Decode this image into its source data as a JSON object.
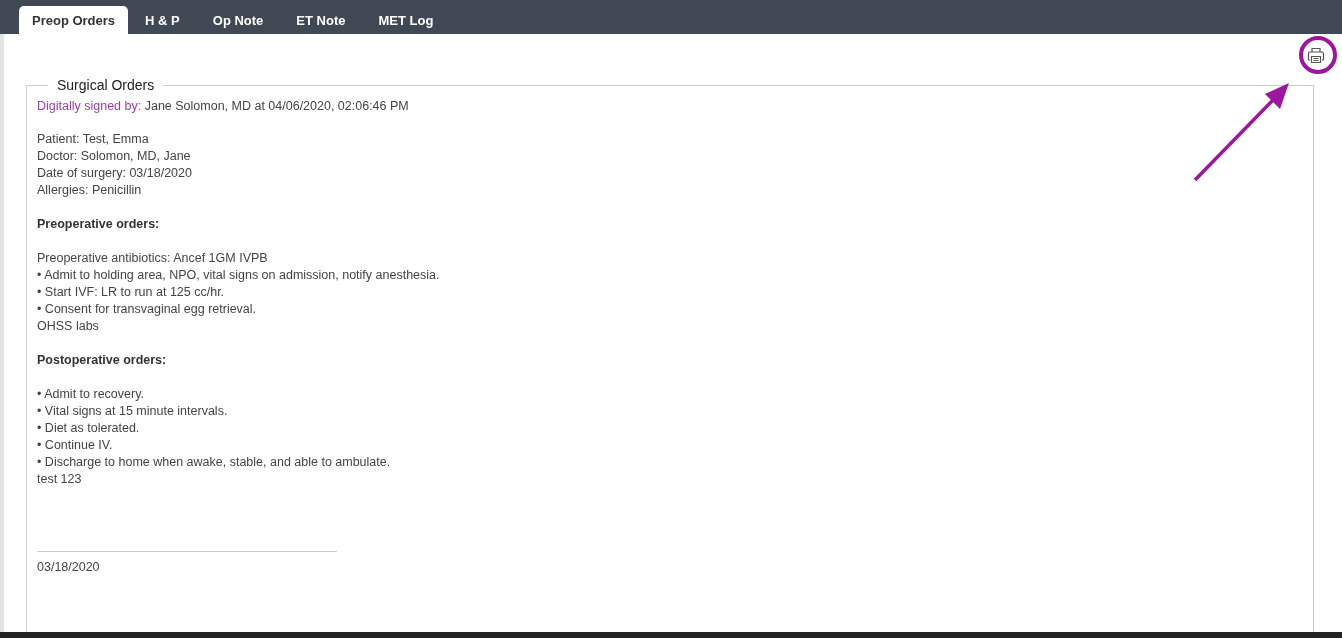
{
  "tabs": [
    {
      "label": "Preop Orders",
      "selected": true
    },
    {
      "label": "H & P",
      "selected": false
    },
    {
      "label": "Op Note",
      "selected": false
    },
    {
      "label": "ET Note",
      "selected": false
    },
    {
      "label": "MET Log",
      "selected": false
    }
  ],
  "document": {
    "title": "Surgical Orders",
    "signature": {
      "label": "Digitally signed by:",
      "value": "Jane Solomon, MD at 04/06/2020, 02:06:46 PM"
    },
    "patient_lines": [
      "Patient: Test, Emma",
      "Doctor: Solomon, MD, Jane",
      "Date of surgery: 03/18/2020",
      "Allergies: Penicillin"
    ],
    "sections": [
      {
        "heading": "Preoperative orders:",
        "lines": [
          "Preoperative antibiotics: Ancef 1GM IVPB",
          "• Admit to holding area, NPO, vital signs on admission, notify anesthesia.",
          "• Start IVF: LR to run at 125 cc/hr.",
          "• Consent for transvaginal egg retrieval.",
          "OHSS labs"
        ]
      },
      {
        "heading": "Postoperative orders:",
        "lines": [
          "• Admit to recovery.",
          "• Vital signs at 15 minute intervals.",
          "• Diet as tolerated.",
          "• Continue IV.",
          "• Discharge to home when awake, stable, and able to ambulate.",
          "test 123"
        ]
      }
    ],
    "sign_date": "03/18/2020"
  }
}
